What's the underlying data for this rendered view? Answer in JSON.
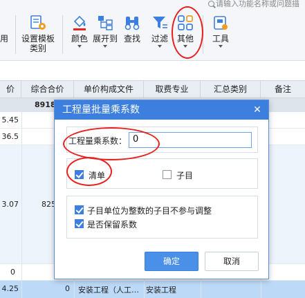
{
  "search": {
    "placeholder": "请输入功能名称或问题描"
  },
  "toolbar": {
    "items": [
      {
        "label": "用",
        "icon": "apply-icon",
        "has_caret": false
      },
      {
        "label": "设置模板",
        "label2": "类别",
        "icon": "template-settings-icon",
        "has_caret": false
      },
      {
        "label": "颜色",
        "icon": "paint-bucket-icon",
        "has_caret": true
      },
      {
        "label": "展开到",
        "icon": "expand-tree-icon",
        "has_caret": true
      },
      {
        "label": "查找",
        "icon": "binoculars-icon",
        "has_caret": false
      },
      {
        "label": "过滤",
        "icon": "filter-icon",
        "has_caret": true
      },
      {
        "label": "其他",
        "icon": "grid-apps-icon",
        "has_caret": true
      },
      {
        "label": "工具",
        "icon": "toolbox-icon",
        "has_caret": true
      }
    ]
  },
  "grid": {
    "columns": [
      "价",
      "综合合价",
      "单价构成文件",
      "取费专业",
      "汇总类别",
      "备注"
    ],
    "header_total": "8918",
    "rows": [
      {
        "price": "5.45",
        "total": ""
      },
      {
        "price": "36.5",
        "total": ""
      },
      {
        "price": "3.07",
        "total": "825"
      },
      {
        "price": "0",
        "total": ""
      },
      {
        "price": "4.25",
        "total": "0",
        "file": "安装工程（人工…",
        "category": "安装工程"
      }
    ]
  },
  "dialog": {
    "title": "工程量批量乘系数",
    "coef_label": "工程量乘系数：",
    "coef_value": "0",
    "opt_bill": "清单",
    "opt_sub": "子目",
    "opt_integer": "子目单位为整数的子目不参与调整",
    "opt_keep": "是否保留系数",
    "ok": "确定",
    "cancel": "取消"
  },
  "colors": {
    "accent": "#3d7fde",
    "annotation": "#e8201e",
    "highlight_row": "#bcd9f7"
  }
}
